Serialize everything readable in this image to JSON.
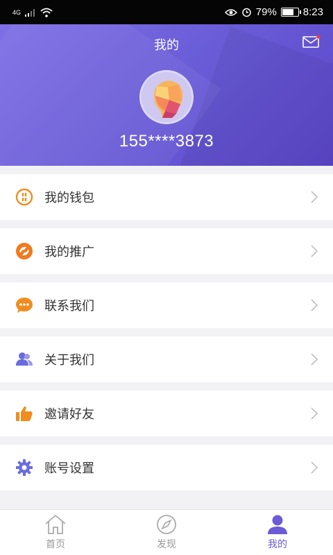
{
  "status_bar": {
    "network": "4G",
    "battery_percent": "79%",
    "battery_level": 0.79,
    "time": "8:23"
  },
  "header": {
    "title": "我的",
    "phone": "155****3873"
  },
  "menu": [
    {
      "label": "我的钱包",
      "icon": "wallet-icon",
      "color": "#f08d1e"
    },
    {
      "label": "我的推广",
      "icon": "promotion-icon",
      "color": "#f07a1e"
    },
    {
      "label": "联系我们",
      "icon": "chat-icon",
      "color": "#f08d1e"
    },
    {
      "label": "关于我们",
      "icon": "users-icon",
      "color": "#6b6be0"
    },
    {
      "label": "邀请好友",
      "icon": "thumbs-up-icon",
      "color": "#f08d1e"
    },
    {
      "label": "账号设置",
      "icon": "gear-icon",
      "color": "#6b6be0"
    }
  ],
  "tabs": [
    {
      "label": "首页",
      "icon": "home-icon",
      "active": false
    },
    {
      "label": "发现",
      "icon": "compass-icon",
      "active": false
    },
    {
      "label": "我的",
      "icon": "user-icon",
      "active": true
    }
  ],
  "colors": {
    "accent": "#6c5bd6",
    "orange": "#f08d1e",
    "header_start": "#7f6fe6",
    "header_end": "#5b46c9"
  }
}
